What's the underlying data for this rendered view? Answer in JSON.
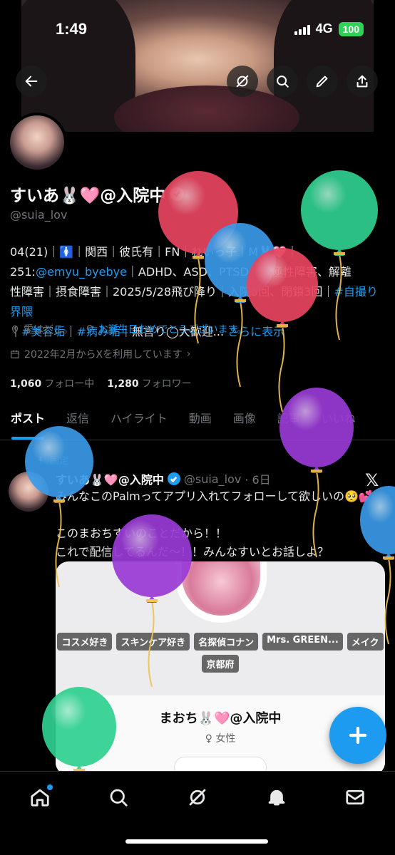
{
  "status_bar": {
    "time": "1:49",
    "network": "4G",
    "battery": "100"
  },
  "header_actions": {
    "back": "back-arrow-icon",
    "grok": "grok-icon",
    "search": "search-icon",
    "edit": "pencil-icon",
    "share": "share-icon"
  },
  "profile": {
    "name": "すいあ🐰🩷@入院中",
    "handle": "@suia_lov",
    "bio_lines": [
      {
        "text": "04(21)｜🚺｜関西｜彼氏有｜FN｜れいっ子｜M🐰🩷｜"
      },
      {
        "text": "251:",
        "link": "@emyu_byebye",
        "rest": "｜ADHD、ASD、PTSD、双極性障害、解離"
      },
      {
        "text": "性障害｜摂食障害｜2025/5/28飛び降り｜入院5回、閉鎖3回｜"
      },
      {
        "link": "#自撮り界隈",
        "rest2link": "｜",
        "link2": "#美容垢",
        "sep2": "｜",
        "link3": "#病み垢",
        "rest": "｜無言り◯大歓迎... ",
        "more": "さらに表示"
      }
    ],
    "location": "愛はどこ。",
    "birthday_link": "お誕生日おめでとうございます。",
    "joined": "2022年2月からXを利用しています",
    "following_count": "1,060",
    "following_label": "フォロー中",
    "followers_count": "1,280",
    "followers_label": "フォロワー"
  },
  "tabs": [
    "ポスト",
    "返信",
    "ハイライト",
    "動画",
    "画像",
    "記事",
    "いいね"
  ],
  "pinned_post": {
    "pinned_label": "固定",
    "author_name": "すいあ🐰🩷@入院中",
    "author_handle": "@suia_lov",
    "time": "· 6日",
    "text": "みんなこのPalmってアプリ入れてフォローして欲しいの🥺💕\n\nこのまおちすいのことだから！！\nこれで配信してるんだ〜！！みんなすいとお話しよ？",
    "card": {
      "tags": [
        "コスメ好き",
        "スキンケア好き",
        "名探偵コナン",
        "Mrs. GREEN...",
        "メイク",
        "京都府"
      ],
      "name": "まおち🐰🩷@入院中",
      "gender": "♀ 女性"
    }
  },
  "bottom_nav": [
    "home-icon",
    "search-icon",
    "grok-icon",
    "notifications-icon",
    "messages-icon"
  ],
  "colors": {
    "accent": "#1d9bf0",
    "background": "#000000",
    "text": "#e7e9ea",
    "muted": "#71767b"
  },
  "balloons": [
    {
      "color": "#e8455f"
    },
    {
      "color": "#2fd08f"
    },
    {
      "color": "#3a9be8"
    },
    {
      "color": "#e8455f"
    },
    {
      "color": "#9a3ad6"
    },
    {
      "color": "#3a9be8"
    },
    {
      "color": "#9a3ad6"
    },
    {
      "color": "#2fd08f"
    },
    {
      "color": "#3a9be8"
    }
  ]
}
